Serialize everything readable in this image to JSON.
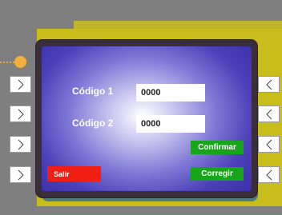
{
  "form": {
    "code1_label": "Código 1",
    "code1_value": "0000",
    "code2_label": "Código 2",
    "code2_value": "0000"
  },
  "buttons": {
    "confirm": "Confirmar",
    "correct": "Corregir",
    "exit": "Salir"
  },
  "side_buttons": {
    "left_icon": "chevron-right-icon",
    "right_icon": "chevron-left-icon"
  },
  "colors": {
    "confirm_green": "#17a51a",
    "exit_red": "#f01e14",
    "screen_blue": "#3a2fa8",
    "pointer_orange": "#f0b03a"
  }
}
